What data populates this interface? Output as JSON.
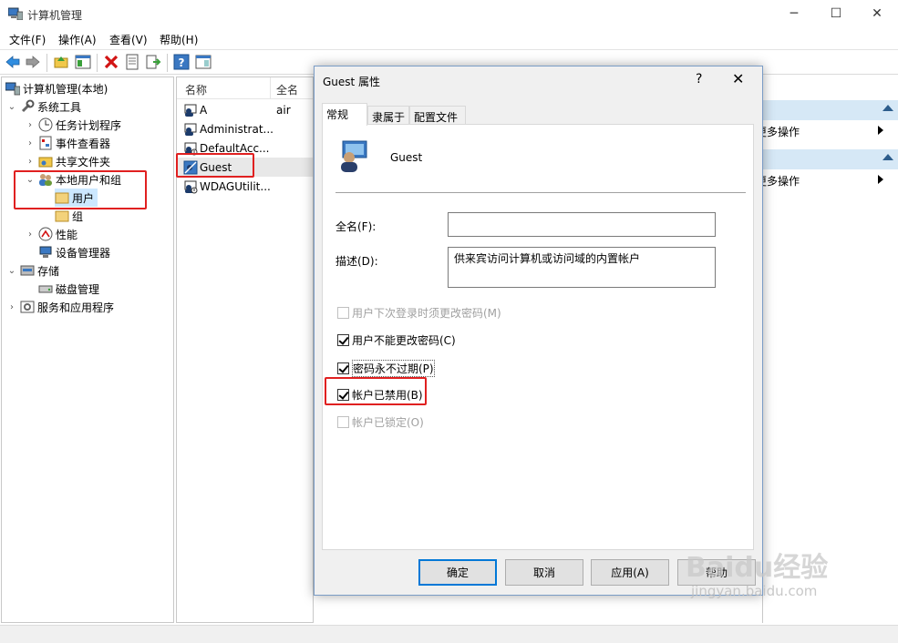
{
  "window": {
    "title": "计算机管理",
    "minimize": "─",
    "maximize": "☐",
    "close": "✕"
  },
  "menu": [
    "文件(F)",
    "操作(A)",
    "查看(V)",
    "帮助(H)"
  ],
  "tree": {
    "root": "计算机管理(本地)",
    "system_tools": "系统工具",
    "task_scheduler": "任务计划程序",
    "event_viewer": "事件查看器",
    "shared_folders": "共享文件夹",
    "local_users_groups": "本地用户和组",
    "users": "用户",
    "groups": "组",
    "performance": "性能",
    "device_manager": "设备管理器",
    "storage": "存储",
    "disk_management": "磁盘管理",
    "services_apps": "服务和应用程序"
  },
  "list": {
    "col_name": "名称",
    "col_fullname": "全名",
    "rows": [
      {
        "name": "A",
        "full": "air"
      },
      {
        "name": "Administrat...",
        "full": ""
      },
      {
        "name": "DefaultAcc...",
        "full": ""
      },
      {
        "name": "Guest",
        "full": ""
      },
      {
        "name": "WDAGUtilit...",
        "full": ""
      }
    ]
  },
  "actions": {
    "more1": "更多操作",
    "more2": "更多操作"
  },
  "dialog": {
    "title": "Guest 属性",
    "help": "?",
    "close": "✕",
    "tabs": [
      "常规",
      "隶属于",
      "配置文件"
    ],
    "user_name": "Guest",
    "fullname_label": "全名(F):",
    "fullname_value": "",
    "desc_label": "描述(D):",
    "desc_value": "供来宾访问计算机或访问域的内置帐户",
    "cb_must_change": "用户下次登录时须更改密码(M)",
    "cb_cannot_change": "用户不能更改密码(C)",
    "cb_never_expires": "密码永不过期(P)",
    "cb_disabled": "帐户已禁用(B)",
    "cb_locked": "帐户已锁定(O)",
    "btn_ok": "确定",
    "btn_cancel": "取消",
    "btn_apply": "应用(A)",
    "btn_help": "帮助"
  },
  "watermark": {
    "brand": "Baidu经验",
    "url": "jingyan.baidu.com"
  }
}
